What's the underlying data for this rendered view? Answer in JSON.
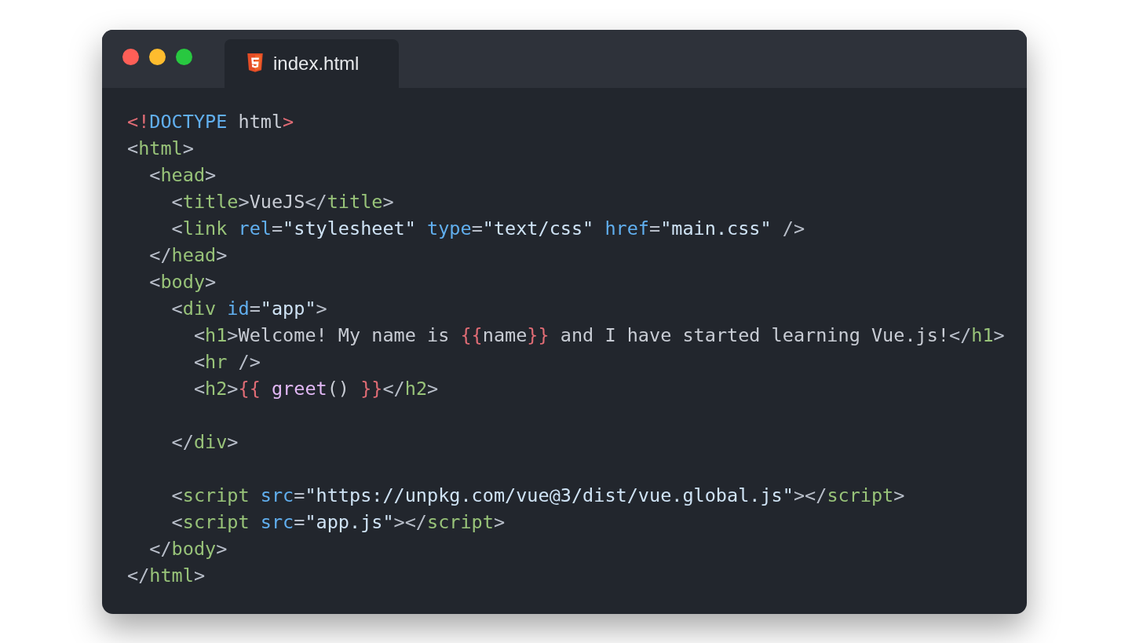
{
  "window": {
    "tab": {
      "label": "index.html",
      "selected": true
    }
  },
  "code_lines": [
    {
      "kind": "code",
      "tokens": [
        {
          "kind": "red",
          "text": "<!"
        },
        {
          "kind": "kw",
          "text": "DOCTYPE"
        },
        {
          "kind": "text",
          "text": " html"
        },
        {
          "kind": "red",
          "text": ">"
        }
      ]
    },
    {
      "kind": "code",
      "tokens": [
        {
          "kind": "punct",
          "text": "<"
        },
        {
          "kind": "tag",
          "text": "html"
        },
        {
          "kind": "punct",
          "text": ">"
        }
      ]
    },
    {
      "kind": "code",
      "tokens": [
        {
          "kind": "punct",
          "text": "  <"
        },
        {
          "kind": "tag",
          "text": "head"
        },
        {
          "kind": "punct",
          "text": ">"
        }
      ]
    },
    {
      "kind": "code",
      "tokens": [
        {
          "kind": "punct",
          "text": "    <"
        },
        {
          "kind": "tag",
          "text": "title"
        },
        {
          "kind": "punct",
          "text": ">"
        },
        {
          "kind": "text",
          "text": "VueJS"
        },
        {
          "kind": "punct",
          "text": "</"
        },
        {
          "kind": "tag",
          "text": "title"
        },
        {
          "kind": "punct",
          "text": ">"
        }
      ]
    },
    {
      "kind": "code",
      "tokens": [
        {
          "kind": "punct",
          "text": "    <"
        },
        {
          "kind": "tag",
          "text": "link"
        },
        {
          "kind": "attr",
          "text": " rel"
        },
        {
          "kind": "punct",
          "text": "="
        },
        {
          "kind": "str",
          "text": "\"stylesheet\""
        },
        {
          "kind": "attr",
          "text": " type"
        },
        {
          "kind": "punct",
          "text": "="
        },
        {
          "kind": "str",
          "text": "\"text/css\""
        },
        {
          "kind": "attr",
          "text": " href"
        },
        {
          "kind": "punct",
          "text": "="
        },
        {
          "kind": "str",
          "text": "\"main.css\""
        },
        {
          "kind": "punct",
          "text": " />"
        }
      ]
    },
    {
      "kind": "code",
      "tokens": [
        {
          "kind": "punct",
          "text": "  </"
        },
        {
          "kind": "tag",
          "text": "head"
        },
        {
          "kind": "punct",
          "text": ">"
        }
      ]
    },
    {
      "kind": "code",
      "tokens": [
        {
          "kind": "punct",
          "text": "  <"
        },
        {
          "kind": "tag",
          "text": "body"
        },
        {
          "kind": "punct",
          "text": ">"
        }
      ]
    },
    {
      "kind": "code",
      "tokens": [
        {
          "kind": "punct",
          "text": "    <"
        },
        {
          "kind": "tag",
          "text": "div"
        },
        {
          "kind": "attr",
          "text": " id"
        },
        {
          "kind": "punct",
          "text": "="
        },
        {
          "kind": "str",
          "text": "\"app\""
        },
        {
          "kind": "punct",
          "text": ">"
        }
      ]
    },
    {
      "kind": "code",
      "tokens": [
        {
          "kind": "punct",
          "text": "      <"
        },
        {
          "kind": "tag",
          "text": "h1"
        },
        {
          "kind": "punct",
          "text": ">"
        },
        {
          "kind": "text",
          "text": "Welcome! My name is "
        },
        {
          "kind": "red",
          "text": "{{"
        },
        {
          "kind": "text",
          "text": "name"
        },
        {
          "kind": "red",
          "text": "}}"
        },
        {
          "kind": "text",
          "text": " and I have started learning Vue.js!"
        },
        {
          "kind": "punct",
          "text": "</"
        },
        {
          "kind": "tag",
          "text": "h1"
        },
        {
          "kind": "punct",
          "text": ">"
        }
      ]
    },
    {
      "kind": "code",
      "tokens": [
        {
          "kind": "punct",
          "text": "      <"
        },
        {
          "kind": "tag",
          "text": "hr"
        },
        {
          "kind": "punct",
          "text": " />"
        }
      ]
    },
    {
      "kind": "code",
      "tokens": [
        {
          "kind": "punct",
          "text": "      <"
        },
        {
          "kind": "tag",
          "text": "h2"
        },
        {
          "kind": "punct",
          "text": ">"
        },
        {
          "kind": "red",
          "text": "{{ "
        },
        {
          "kind": "func",
          "text": "greet"
        },
        {
          "kind": "text",
          "text": "() "
        },
        {
          "kind": "red",
          "text": "}}"
        },
        {
          "kind": "punct",
          "text": "</"
        },
        {
          "kind": "tag",
          "text": "h2"
        },
        {
          "kind": "punct",
          "text": ">"
        }
      ]
    },
    {
      "kind": "blank"
    },
    {
      "kind": "code",
      "tokens": [
        {
          "kind": "punct",
          "text": "    </"
        },
        {
          "kind": "tag",
          "text": "div"
        },
        {
          "kind": "punct",
          "text": ">"
        }
      ]
    },
    {
      "kind": "blank"
    },
    {
      "kind": "code",
      "tokens": [
        {
          "kind": "punct",
          "text": "    <"
        },
        {
          "kind": "tag",
          "text": "script"
        },
        {
          "kind": "attr",
          "text": " src"
        },
        {
          "kind": "punct",
          "text": "="
        },
        {
          "kind": "str",
          "text": "\"https://unpkg.com/vue@3/dist/vue.global.js\""
        },
        {
          "kind": "punct",
          "text": "></"
        },
        {
          "kind": "tag",
          "text": "script"
        },
        {
          "kind": "punct",
          "text": ">"
        }
      ]
    },
    {
      "kind": "code",
      "tokens": [
        {
          "kind": "punct",
          "text": "    <"
        },
        {
          "kind": "tag",
          "text": "script"
        },
        {
          "kind": "attr",
          "text": " src"
        },
        {
          "kind": "punct",
          "text": "="
        },
        {
          "kind": "str",
          "text": "\"app.js\""
        },
        {
          "kind": "punct",
          "text": "></"
        },
        {
          "kind": "tag",
          "text": "script"
        },
        {
          "kind": "punct",
          "text": ">"
        }
      ]
    },
    {
      "kind": "code",
      "tokens": [
        {
          "kind": "punct",
          "text": "  </"
        },
        {
          "kind": "tag",
          "text": "body"
        },
        {
          "kind": "punct",
          "text": ">"
        }
      ]
    },
    {
      "kind": "code",
      "tokens": [
        {
          "kind": "punct",
          "text": "</"
        },
        {
          "kind": "tag",
          "text": "html"
        },
        {
          "kind": "punct",
          "text": ">"
        }
      ]
    }
  ]
}
